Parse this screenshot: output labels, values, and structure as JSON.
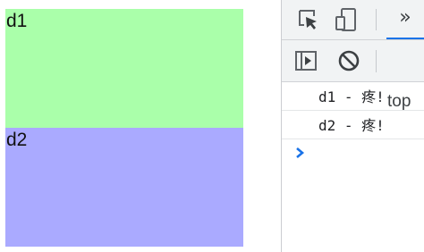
{
  "page": {
    "boxes": [
      {
        "label": "d1",
        "color": "#aaffaa"
      },
      {
        "label": "d2",
        "color": "#aaaaff"
      }
    ]
  },
  "devtools": {
    "toolbar": {
      "inspect_icon": "inspect-element-icon",
      "device_icon": "device-toggle-icon",
      "more_tabs": "»",
      "sidebar_icon": "show-sidebar-icon",
      "clear_icon": "clear-console-icon",
      "context": "top",
      "active_color": "#1a73e8"
    },
    "console": {
      "messages": [
        "d1 - 疼!",
        "d2 - 疼!"
      ],
      "prompt_icon": "console-prompt-chevron-icon"
    }
  }
}
